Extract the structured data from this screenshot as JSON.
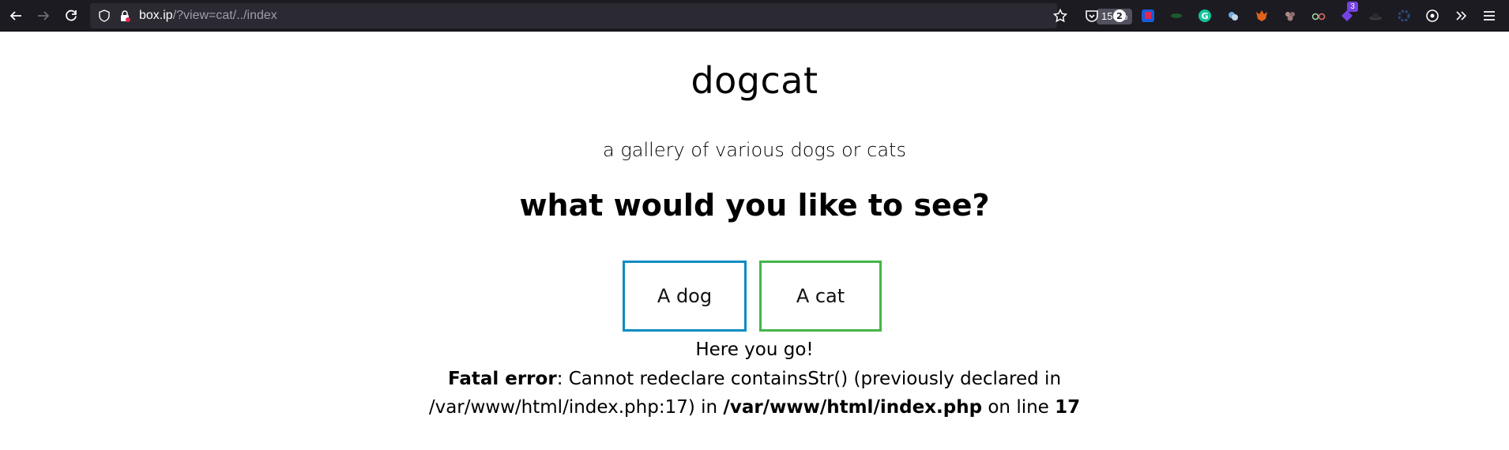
{
  "browser": {
    "url_host": "box.ip",
    "url_path": "/?view=cat/../index",
    "zoom": "150%",
    "extension_badges": {
      "tab_count": "2",
      "notification": "3"
    }
  },
  "page": {
    "title": "dogcat",
    "subtitle": "a gallery of various dogs or cats",
    "question": "what would you like to see?",
    "buttons": {
      "dog": "A dog",
      "cat": "A cat"
    },
    "here": "Here you go!",
    "error": {
      "label": "Fatal error",
      "message": ": Cannot redeclare containsStr() (previously declared in /var/www/html/index.php:17) in ",
      "file": "/var/www/html/index.php",
      "on_line": " on line ",
      "line": "17"
    }
  },
  "colors": {
    "chrome_bg": "#1c1b22",
    "urlbar_bg": "#2b2a33",
    "dog_border": "#0a8cc2",
    "cat_border": "#44b649"
  }
}
